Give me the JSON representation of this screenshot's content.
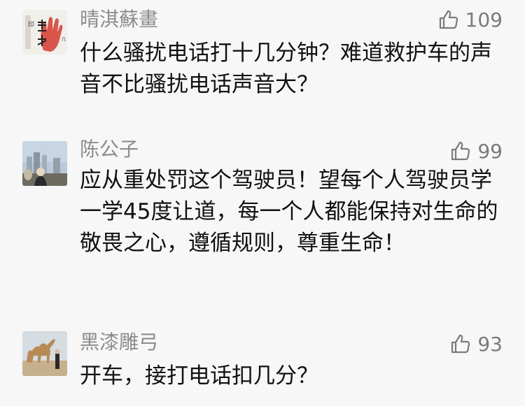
{
  "comments": [
    {
      "username": "晴淇蘇畫",
      "likes": "109",
      "text": "什么骚扰电话打十几分钟？难道救护车的声音不比骚扰电话声音大？",
      "avatar_icon": "handprint-calligraphy-avatar"
    },
    {
      "username": "陈公子",
      "likes": "99",
      "text": "应从重处罚这个驾驶员！望每个人驾驶员学一学45度让道，每一个人都能保持对生命的敬畏之心，遵循规则，尊重生命！",
      "avatar_icon": "city-skyline-person-avatar"
    },
    {
      "username": "黑漆雕弓",
      "likes": "93",
      "text": "开车，接打电话扣几分？",
      "avatar_icon": "camel-desert-avatar"
    }
  ],
  "colors": {
    "background": "#f7f7f7",
    "username": "#8c8c8c",
    "text": "#111111",
    "likes": "#7b7b7b"
  }
}
